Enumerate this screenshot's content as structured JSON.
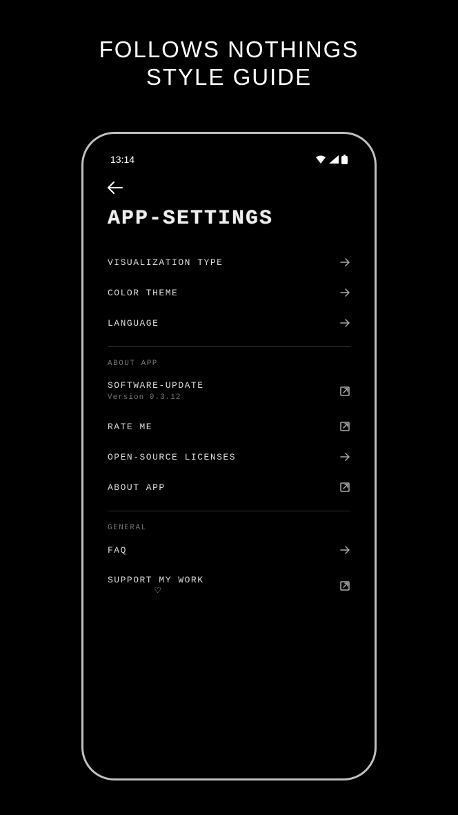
{
  "promo": {
    "headline_l1": "FOLLOWS NOTHINGS",
    "headline_l2": "STYLE GUIDE"
  },
  "status_bar": {
    "time": "13:14"
  },
  "page": {
    "title": "APP-SETTINGS"
  },
  "sections": {
    "display": {
      "items": {
        "visualization": {
          "label": "VISUALIZATION TYPE"
        },
        "color_theme": {
          "label": "COLOR THEME"
        },
        "language": {
          "label": "LANGUAGE"
        }
      }
    },
    "about": {
      "header": "ABOUT APP",
      "items": {
        "software_update": {
          "label": "SOFTWARE-UPDATE",
          "sublabel": "Version 0.3.12"
        },
        "rate_me": {
          "label": "RATE ME"
        },
        "oss_licenses": {
          "label": "OPEN-SOURCE LICENSES"
        },
        "about_app": {
          "label": "ABOUT APP"
        }
      }
    },
    "general": {
      "header": "GENERAL",
      "items": {
        "faq": {
          "label": "FAQ"
        },
        "support": {
          "label": "SUPPORT MY WORK"
        }
      }
    }
  }
}
